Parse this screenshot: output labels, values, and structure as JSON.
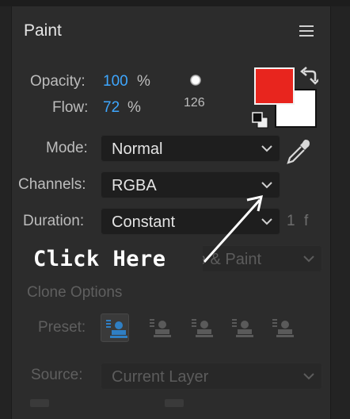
{
  "panel": {
    "title": "Paint"
  },
  "opacity": {
    "label": "Opacity:",
    "value": "100",
    "unit": "%"
  },
  "flow": {
    "label": "Flow:",
    "value": "72",
    "unit": "%"
  },
  "brush_size": "126",
  "colors": {
    "foreground": "#e8251e",
    "background": "#ffffff",
    "accent_value": "#3ea7ff"
  },
  "mode": {
    "label": "Mode:",
    "value": "Normal"
  },
  "channels": {
    "label": "Channels:",
    "value": "RGBA"
  },
  "duration": {
    "label": "Duration:",
    "value": "Constant",
    "frames": "1",
    "frames_unit": "f"
  },
  "erase": {
    "value_partial": "Layer Source & Paint"
  },
  "clone_options": {
    "title": "Clone Options"
  },
  "preset": {
    "label": "Preset:"
  },
  "source": {
    "label": "Source:",
    "value": "Current Layer"
  },
  "annotation": {
    "text": "Click Here"
  }
}
